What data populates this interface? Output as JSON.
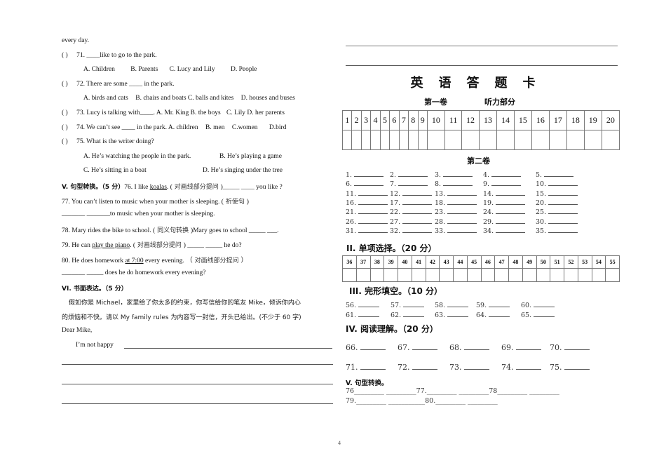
{
  "left": {
    "intro_tail": "every day.",
    "questions": [
      {
        "num": "71.",
        "stem": "____like to go to the park.",
        "options": [
          "A. Children",
          "B. Parents",
          "C. Lucy and Lily",
          "D. People"
        ]
      },
      {
        "num": "72.",
        "stem": "There are some ____ in the park.",
        "options": [
          "A. birds and cats",
          "B. chairs and boats",
          "C. balls and kites",
          "D. houses and buses"
        ]
      },
      {
        "num": "73.",
        "stem": "Lucy is talking with____.",
        "options": [
          "A. Mr. King",
          "B. the boys",
          "C. Lily",
          "D. her parents"
        ]
      },
      {
        "num": "74.",
        "stem": "We can’t see ____ in the park.",
        "options": [
          "A. children",
          "B. men",
          "C.women",
          "D.bird"
        ]
      },
      {
        "num": "75.",
        "stem": "What is the writer doing?",
        "options": [
          "A. He’s watching the people in the park.",
          "B. He’s playing a game",
          "C. He’s sitting in a boat",
          "D. He’s singing under the tree"
        ]
      }
    ],
    "paren": "(      )",
    "section5": {
      "heading": "V. 句型转换。（5 分）",
      "q76": {
        "pre": "76. I like ",
        "underlined": "koalas",
        "post": ". (",
        "hint": " 对画线部分提问 ",
        "tail": ")_____   ____  you like ?"
      },
      "q77": {
        "pre": "77. You can’t listen to music when your mother is sleeping. (",
        "hint": " 祈使句 ",
        "tail": ")"
      },
      "q77_answer": "_______     _______to music when your mother is sleeping.",
      "q78": {
        "pre": "78. Mary rides the bike to school. (",
        "hint": " 同义句转换 ",
        "tail": ")Mary goes to school  _____  ___."
      },
      "q79": {
        "pre": "79. He can ",
        "underlined": "play the piano",
        "post": ". (",
        "hint": " 对画线部分提问 ",
        "tail": ")    _____    _____   he do?"
      },
      "q80": {
        "pre": "80. He does homework ",
        "underlined": "at 7:00",
        "post": " every evening.  （",
        "hint": " 对画线部分提问 ",
        "tail": "）"
      },
      "q80_answer": "_______     _____   does he do homework every evening?"
    },
    "section6": {
      "heading": "VI. 书面表达。（5 分）",
      "prompt_line1": "假如你是 Michael，家里给了你太多的约束，你写信给你的笔友 Mike，倾诉你内心",
      "prompt_line2": "的烦恼和不快。请以 My family rules  为内容写一封信，开头已给出。(不少于 60 字)",
      "greeting": "Dear Mike,",
      "opening": "I’m not happy"
    }
  },
  "right": {
    "title": "英语答题卡",
    "part1_label": "第一卷",
    "part1_sub": "听力部分",
    "listening_numbers": [
      "1",
      "2",
      "3",
      "4",
      "5",
      "6",
      "7",
      "8",
      "9",
      "10",
      "11",
      "12",
      "13",
      "14",
      "15",
      "16",
      "17",
      "18",
      "19",
      "20"
    ],
    "part2_label": "第二卷",
    "part2_rows": [
      [
        "1.",
        "2.",
        "3.",
        "4.",
        "5."
      ],
      [
        "6.",
        "7.",
        "8.",
        "9.",
        "10."
      ],
      [
        "11.",
        "12.",
        "13.",
        "14.",
        "15."
      ],
      [
        "16.",
        "17.",
        "18.",
        "19.",
        "20."
      ],
      [
        "21.",
        "22.",
        "23.",
        "24.",
        "25."
      ],
      [
        "26.",
        "27.",
        "28.",
        "29.",
        "30."
      ],
      [
        "31.",
        "32.",
        "33.",
        "34.",
        "35."
      ]
    ],
    "sec2_heading": "II. 单项选择。（20 分）",
    "choice_numbers": [
      "36",
      "37",
      "38",
      "39",
      "40",
      "41",
      "42",
      "43",
      "44",
      "45",
      "46",
      "47",
      "48",
      "49",
      "50",
      "51",
      "52",
      "53",
      "54",
      "55"
    ],
    "sec3_heading": "III. 完形填空。（10 分）",
    "cloze_rows": [
      [
        "56.",
        "57.",
        "58.",
        "59.",
        "60."
      ],
      [
        "61.",
        "62.",
        "63.",
        "64.",
        "65."
      ]
    ],
    "sec4_heading": "IV. 阅读理解。（20 分）",
    "reading_rows": [
      [
        "66.",
        "67.",
        "68.",
        "69.",
        "70."
      ],
      [
        "71.",
        "72.",
        "73.",
        "74.",
        "75."
      ]
    ],
    "sec5_heading": "V. 句型转换。",
    "sec5_line1": "76_________  _________77._________  _________78_________  _________",
    "sec5_line2": "79._________  ___________80._________  _________"
  },
  "page_number": "4"
}
